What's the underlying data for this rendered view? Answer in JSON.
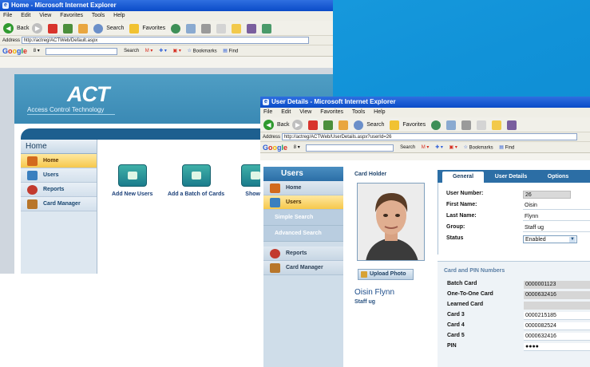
{
  "window_main": {
    "title": "Home - Microsoft Internet Explorer",
    "menu": [
      "File",
      "Edit",
      "View",
      "Favorites",
      "Tools",
      "Help"
    ],
    "toolbar": {
      "back_label": "Back",
      "search_label": "Search",
      "favorites_label": "Favorites"
    },
    "address": {
      "label": "Address",
      "url": "http://actreg/ACTWeb/Default.aspx"
    },
    "google": {
      "search_label": "Search",
      "bookmarks_label": "Bookmarks",
      "find_label": "Find"
    },
    "app": {
      "logo": "ACT",
      "logo_sub": "Access Control Technology",
      "sidebar_title": "Home",
      "sidebar_items": [
        "Home",
        "Users",
        "Reports",
        "Card Manager"
      ],
      "tiles": [
        "Add New Users",
        "Add a Batch of Cards",
        "Show A"
      ]
    }
  },
  "window_user": {
    "title": "User Details - Microsoft Internet Explorer",
    "menu": [
      "File",
      "Edit",
      "View",
      "Favorites",
      "Tools",
      "Help"
    ],
    "toolbar": {
      "back_label": "Back",
      "search_label": "Search",
      "favorites_label": "Favorites"
    },
    "address": {
      "label": "Address",
      "url": "http://actreg/ACTWeb/UserDetails.aspx?userId=26"
    },
    "google": {
      "search_label": "Search",
      "bookmarks_label": "Bookmarks",
      "find_label": "Find"
    },
    "sidebar_title": "Users",
    "sidebar_items_top": [
      "Home",
      "Users"
    ],
    "sidebar_links": [
      "Simple Search",
      "Advanced Search"
    ],
    "sidebar_items_bottom": [
      "Reports",
      "Card Manager"
    ],
    "card_holder_heading": "Card Holder",
    "upload_button": "Upload Photo",
    "holder_name": "Oisin Flynn",
    "holder_group": "Staff ug",
    "tabs": [
      "General",
      "User Details",
      "Options"
    ],
    "fields": [
      {
        "label": "User Number:",
        "value": "26"
      },
      {
        "label": "First Name:",
        "value": "Oisin"
      },
      {
        "label": "Last Name:",
        "value": "Flynn"
      },
      {
        "label": "Group:",
        "value": "Staff ug"
      },
      {
        "label": "Status",
        "value": "Enabled"
      }
    ],
    "cards_heading": "Card and PIN Numbers",
    "cards": [
      {
        "label": "Batch Card",
        "value": "0000001123"
      },
      {
        "label": "One-To-One Card",
        "value": "0000632416"
      },
      {
        "label": "Learned Card",
        "value": ""
      },
      {
        "label": "Card 3",
        "value": "0000215185"
      },
      {
        "label": "Card 4",
        "value": "0000082524"
      },
      {
        "label": "Card 5",
        "value": "0000632416"
      },
      {
        "label": "PIN",
        "value": "●●●●"
      }
    ]
  }
}
